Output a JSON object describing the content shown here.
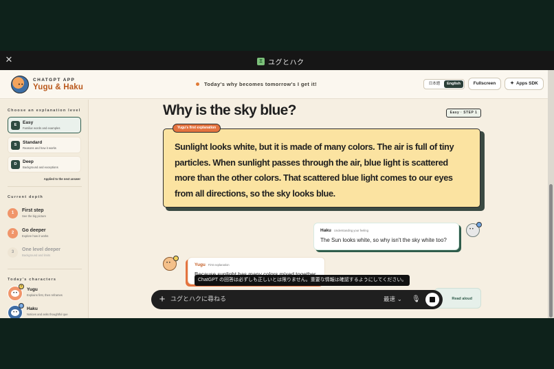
{
  "window": {
    "close_glyph": "✕",
    "title": "ユグとハク",
    "app_tile_glyph": "Ξ"
  },
  "header": {
    "app_label": "CHATGPT APP",
    "app_name": "Yugu & Haku",
    "why_text": "Today's why becomes tomorrow's I get it!",
    "languages": [
      {
        "label": "日本語",
        "selected": false
      },
      {
        "label": "English",
        "selected": true
      }
    ],
    "fullscreen_label": "Fullscreen",
    "apps_sdk_label": "Apps SDK",
    "apps_sdk_icon": "sparkle-icon"
  },
  "sidebar": {
    "level_title": "Choose an explanation level",
    "levels": [
      {
        "badge": "E",
        "name": "Easy",
        "desc": "Familiar words and examples",
        "selected": true
      },
      {
        "badge": "S",
        "name": "Standard",
        "desc": "Reasons and how it works",
        "selected": false
      },
      {
        "badge": "D",
        "name": "Deep",
        "desc": "Background and exceptions",
        "selected": false
      }
    ],
    "applied_note": "Applied to the next answer",
    "depth_title": "Current depth",
    "steps": [
      {
        "num": "1",
        "name": "First step",
        "desc": "See the big picture",
        "active": true
      },
      {
        "num": "2",
        "name": "Go deeper",
        "desc": "Explore how it works",
        "active": true
      },
      {
        "num": "3",
        "name": "One level deeper",
        "desc": "Background and limits",
        "active": false
      }
    ],
    "characters_title": "Today's characters",
    "characters": [
      {
        "name": "Yugu",
        "desc": "Explains first, then reframes",
        "badge": "?"
      },
      {
        "name": "Haku",
        "desc": "Notices and asks thoughtful que",
        "badge": "!"
      }
    ]
  },
  "main": {
    "title": "Why is the sky blue?",
    "step_tag": "Easy · STEP 1",
    "explain_tag": "Yugu's first explanation",
    "explanation": "Sunlight looks white, but it is made of many colors. The air is full of tiny particles. When sunlight passes through the air, blue light is scattered more than the other colors. That scattered blue light comes to our eyes from all directions, so the sky looks blue.",
    "haku_bubble": {
      "name": "Haku",
      "sub": "Understanding your feeling",
      "text": "The Sun looks white, so why isn't the sky white too?"
    },
    "yugu_bubble": {
      "name": "Yugu",
      "sub": "First explanation",
      "text": "Because sunlight has many colors mixed together."
    },
    "read_aloud_label": "Read aloud"
  },
  "composer": {
    "disclaimer": "ChatGPT の回答は必ずしも正しいとは限りません。重要な情報は確認するようにしてください。",
    "plus_glyph": "+",
    "placeholder": "ユグとハクに尋ねる",
    "model_label": "最速 ⌄",
    "mic_glyph": "🎙"
  },
  "colors": {
    "accent_orange": "#e4733f",
    "accent_green": "#2f5c4b",
    "card_yellow": "#fbe3a1",
    "page_bg": "#f6efe2",
    "chrome_dark": "#0e221b"
  }
}
